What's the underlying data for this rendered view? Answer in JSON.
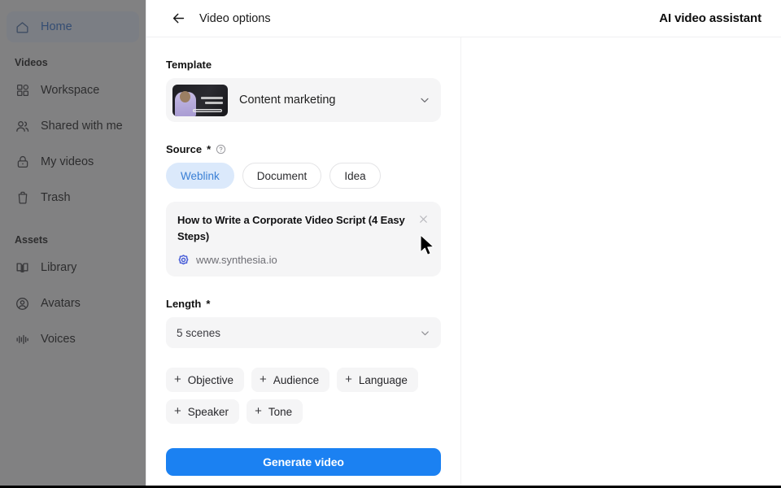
{
  "sidebar": {
    "items": [
      {
        "label": "Home",
        "icon": "home-icon",
        "active": true
      }
    ],
    "groups": [
      {
        "title": "Videos",
        "items": [
          {
            "label": "Workspace",
            "icon": "grid-icon"
          },
          {
            "label": "Shared with me",
            "icon": "users-icon"
          },
          {
            "label": "My videos",
            "icon": "lock-icon"
          },
          {
            "label": "Trash",
            "icon": "trash-icon"
          }
        ]
      },
      {
        "title": "Assets",
        "items": [
          {
            "label": "Library",
            "icon": "book-icon"
          },
          {
            "label": "Avatars",
            "icon": "user-circle-icon"
          },
          {
            "label": "Voices",
            "icon": "waveform-icon"
          }
        ]
      }
    ]
  },
  "header": {
    "back_icon": "arrow-left-icon",
    "title": "Video options",
    "right_title": "AI video assistant"
  },
  "form": {
    "template": {
      "label": "Template",
      "value": "Content marketing",
      "chevron_icon": "chevron-down-icon",
      "thumbnail_name": "template-thumbnail"
    },
    "source": {
      "label": "Source",
      "required_marker": "*",
      "help_icon": "question-circle-icon",
      "options": [
        "Weblink",
        "Document",
        "Idea"
      ],
      "selected": "Weblink"
    },
    "weblink": {
      "title": "How to Write a Corporate Video Script (4 Easy Steps)",
      "host": "www.synthesia.io",
      "favicon_name": "synthesia-favicon",
      "close_icon": "close-icon"
    },
    "length": {
      "label": "Length",
      "required_marker": "*",
      "value": "5 scenes",
      "chevron_icon": "chevron-down-icon"
    },
    "add_options": [
      {
        "label": "Objective"
      },
      {
        "label": "Audience"
      },
      {
        "label": "Language"
      },
      {
        "label": "Speaker"
      },
      {
        "label": "Tone"
      }
    ],
    "generate_label": "Generate video"
  },
  "colors": {
    "accent_blue": "#1b81f2",
    "chip_selected_bg": "#dbe9fb",
    "chip_selected_text": "#3a7fd5",
    "sidebar_active_text": "#2f6fd0",
    "panel_gray": "#f5f5f6"
  }
}
